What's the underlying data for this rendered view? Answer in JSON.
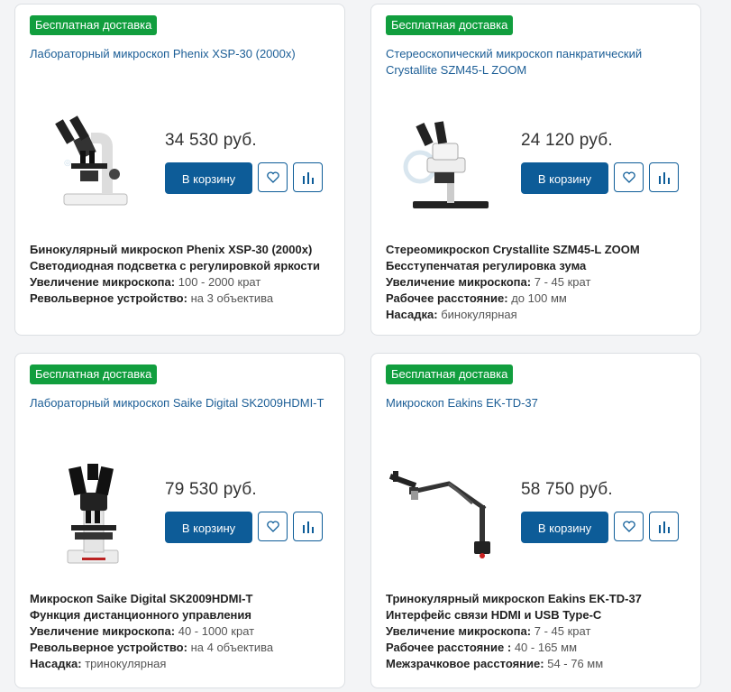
{
  "products": [
    {
      "badge": "Бесплатная доставка",
      "title": "Лабораторный микроскоп Phenix XSP-30 (2000x)",
      "price": "34 530 руб.",
      "cart_label": "В корзину",
      "image_icon": "binocular-microscope",
      "model_line": "Бинокулярный микроскоп Phenix XSP-30 (2000x)",
      "feature_line": "Светодиодная подсветка с регулировкой яркости",
      "specs": [
        {
          "label": "Увеличение микроскопа:",
          "value": "100 - 2000 крат"
        },
        {
          "label": "Револьверное устройство:",
          "value": "на 3 объектива"
        }
      ]
    },
    {
      "badge": "Бесплатная доставка",
      "title": "Стереоскопический микроскоп панкратический Crystallite SZM45-L ZOOM",
      "price": "24 120 руб.",
      "cart_label": "В корзину",
      "image_icon": "stereo-microscope",
      "model_line": "Стереомикроскоп Crystallite SZM45-L ZOOM",
      "feature_line": "Бесступенчатая регулировка зума",
      "specs": [
        {
          "label": "Увеличение микроскопа:",
          "value": "7 - 45 крат"
        },
        {
          "label": "Рабочее расстояние:",
          "value": "до 100 мм"
        },
        {
          "label": "Насадка:",
          "value": "бинокулярная"
        }
      ]
    },
    {
      "badge": "Бесплатная доставка",
      "title": "Лабораторный микроскоп Saike Digital SK2009HDMI-T",
      "price": "79 530 руб.",
      "cart_label": "В корзину",
      "image_icon": "trinocular-microscope",
      "model_line": "Микроскоп Saike Digital SK2009HDMI-T",
      "feature_line": "Функция дистанционного управления",
      "specs": [
        {
          "label": "Увеличение микроскопа:",
          "value": "40 - 1000 крат"
        },
        {
          "label": "Револьверное устройство:",
          "value": "на 4 объектива"
        },
        {
          "label": "Насадка:",
          "value": "тринокулярная"
        }
      ]
    },
    {
      "badge": "Бесплатная доставка",
      "title": "Микроскоп Eakins EK-TD-37",
      "price": "58 750 руб.",
      "cart_label": "В корзину",
      "image_icon": "boom-stand-microscope",
      "model_line": "Тринокулярный микроскоп Eakins EK-TD-37",
      "feature_line": "Интерфейс связи HDMI и USB Type-C",
      "specs": [
        {
          "label": "Увеличение микроскопа:",
          "value": "7 - 45 крат"
        },
        {
          "label": "Рабочее расстояние :",
          "value": "40 - 165 мм"
        },
        {
          "label": "Межзрачковое расстояние:",
          "value": "54 - 76 мм"
        }
      ]
    }
  ],
  "colors": {
    "badge": "#119e3e",
    "title_link": "#1c5e96",
    "button": "#0d5c98"
  }
}
